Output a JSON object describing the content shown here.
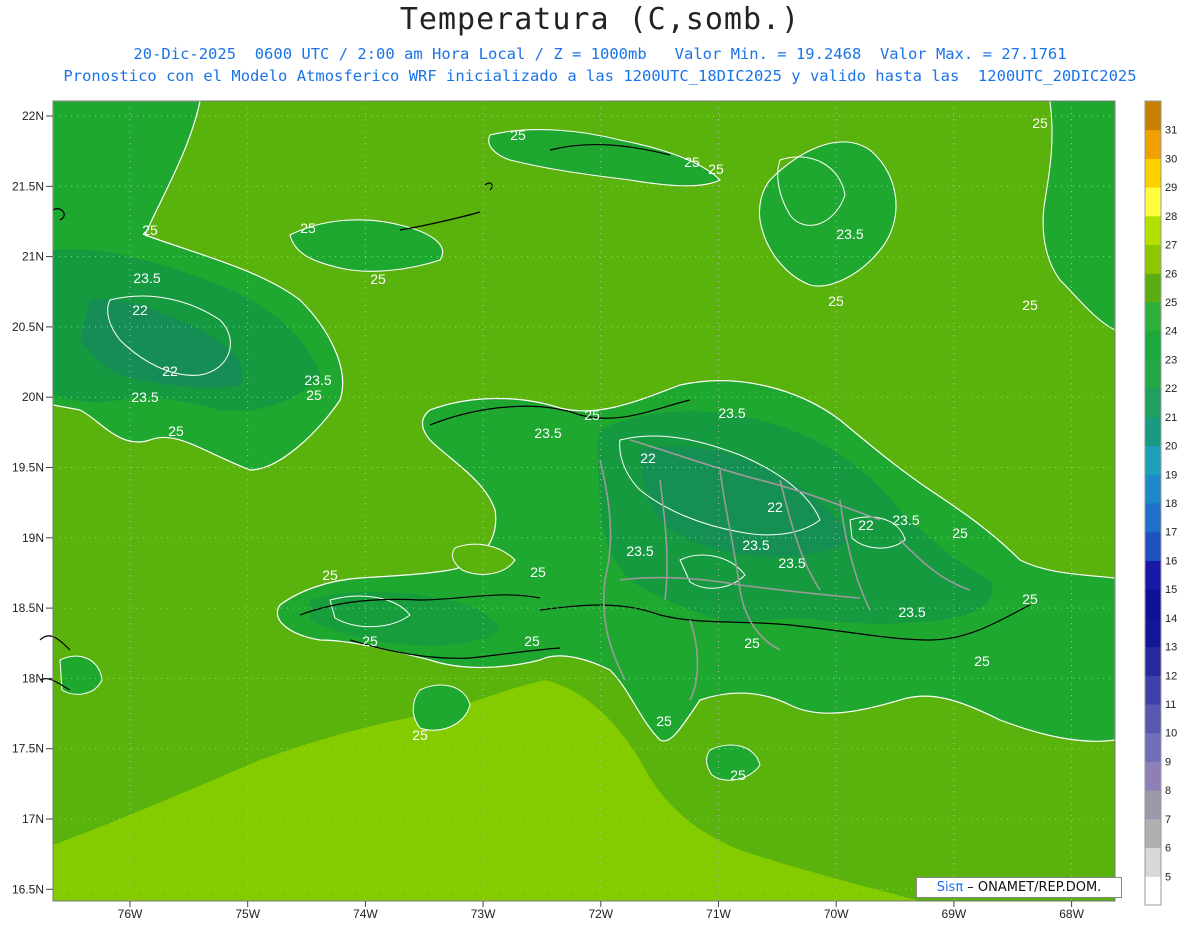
{
  "title": "Temperatura (C,somb.)",
  "subtitle_1": "20-Dic-2025  0600 UTC / 2:00 am Hora Local / Z = 1000mb   Valor Min. = 19.2468  Valor Max. = 27.1761",
  "subtitle_2": "Pronostico con el Modelo Atmosferico WRF inicializado a las 1200UTC_18DIC2025 y valido hasta las  1200UTC_20DIC2025",
  "credit": {
    "brand": "Sisπ",
    "text": " – ONAMET/REP.DOM."
  },
  "lat_labels": [
    "22N",
    "21.5N",
    "21N",
    "20.5N",
    "20N",
    "19.5N",
    "19N",
    "18.5N",
    "18N",
    "17.5N",
    "17N",
    "16.5N"
  ],
  "lon_labels": [
    "76W",
    "75W",
    "74W",
    "73W",
    "72W",
    "71W",
    "70W",
    "69W",
    "68W"
  ],
  "contour_labels": [
    "25",
    "23.5",
    "22"
  ],
  "colorbar": {
    "levels": [
      "5",
      "6",
      "7",
      "8",
      "9",
      "10",
      "11",
      "12",
      "13",
      "14",
      "15",
      "16",
      "17",
      "18",
      "19",
      "20",
      "21",
      "22",
      "23",
      "24",
      "25",
      "26",
      "27",
      "28",
      "29",
      "30",
      "31"
    ],
    "colors": [
      "#ffffff",
      "#d8d8d8",
      "#b0b0b0",
      "#9a9aaa",
      "#8e7fb7",
      "#7070b8",
      "#5858b0",
      "#4040aa",
      "#2828a0",
      "#141498",
      "#101096",
      "#1818a8",
      "#1e50c0",
      "#1e70c8",
      "#1e88c8",
      "#1ea0b8",
      "#1a9a80",
      "#1fa060",
      "#22a845",
      "#1ca83a",
      "#2cb03a",
      "#5cae10",
      "#8cc800",
      "#b4e000",
      "#ffff40",
      "#ffd000",
      "#f0a000",
      "#c88000"
    ],
    "top_color": "#c88000"
  },
  "palette": {
    "sea": "#5ab20c",
    "land_mid": "#1fa830",
    "land_cool": "#169a40",
    "land_cold": "#178a5a",
    "warm": "#84cc00",
    "border": "#999999",
    "coast": "#000000",
    "contour": "#ffffff"
  }
}
